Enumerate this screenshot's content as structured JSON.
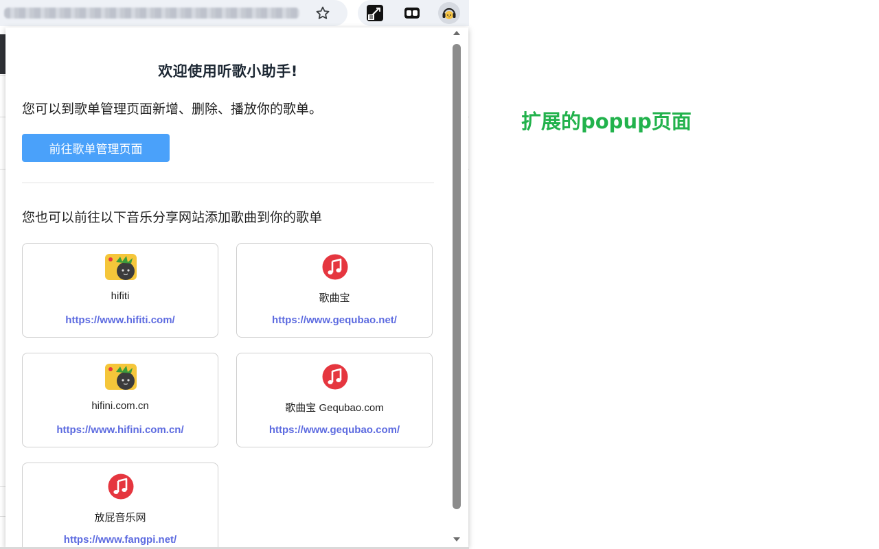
{
  "popup": {
    "title": "欢迎使用听歌小助手!",
    "description": "您可以到歌单管理页面新增、删除、播放你的歌单。",
    "manage_button_label": "前往歌单管理页面",
    "sites_heading": "您也可以前往以下音乐分享网站添加歌曲到你的歌单",
    "sites": [
      {
        "name": "hifiti",
        "url": "https://www.hifiti.com/",
        "icon": "pineapple-logo-icon"
      },
      {
        "name": "歌曲宝",
        "url": "https://www.gequbao.net/",
        "icon": "music-note-icon"
      },
      {
        "name": "hifini.com.cn",
        "url": "https://www.hifini.com.cn/",
        "icon": "pineapple-logo-icon"
      },
      {
        "name": "歌曲宝 Gequbao.com",
        "url": "https://www.gequbao.com/",
        "icon": "music-note-icon"
      },
      {
        "name": "放屁音乐网",
        "url": "https://www.fangpi.net/",
        "icon": "music-note-icon"
      }
    ]
  },
  "toolbar": {
    "icons": [
      "star-icon",
      "translate-extension-icon",
      "tab-extension-icon",
      "music-assistant-extension-icon"
    ]
  },
  "annotation": {
    "text": "扩展的popup页面"
  },
  "colors": {
    "button": "#4aa1fa",
    "link": "#5d6be0",
    "annotation": "#22b24c",
    "music_icon": "#e5363f",
    "pineapple_bg": "#f5c63a"
  }
}
